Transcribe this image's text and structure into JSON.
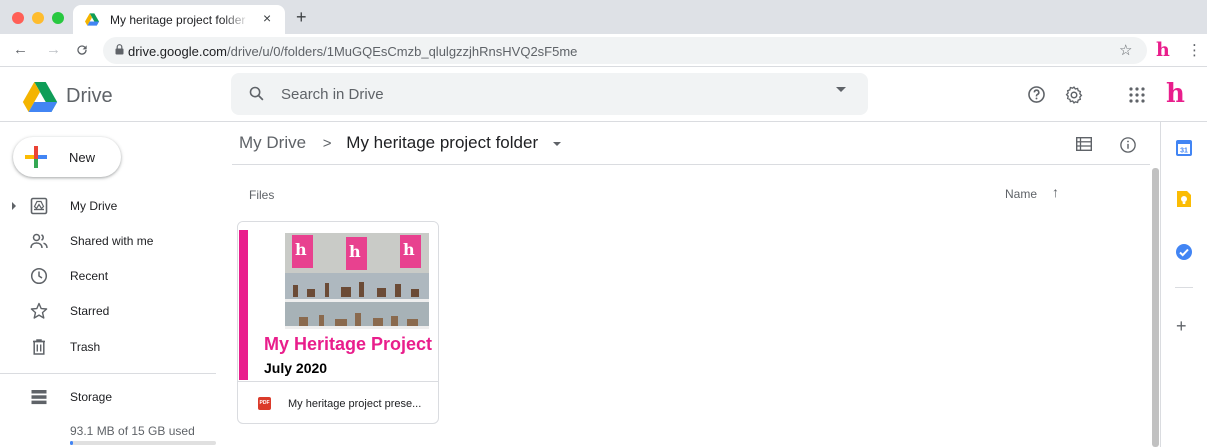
{
  "browser": {
    "tab_title": "My heritage project folder - Google Drive",
    "new_tab_label": "+",
    "close_label": "×",
    "url_host": "drive.google.com",
    "url_path": "/drive/u/0/folders/1MuGQEsCmzb_qlulgzzjhRnsHVQ2sF5me"
  },
  "drive": {
    "app_title": "Drive",
    "search_placeholder": "Search in Drive",
    "brand_letter": "h"
  },
  "sidebar": {
    "new_label": "New",
    "items": [
      {
        "label": "My Drive",
        "icon": "my-drive-icon"
      },
      {
        "label": "Shared with me",
        "icon": "people-icon"
      },
      {
        "label": "Recent",
        "icon": "clock-icon"
      },
      {
        "label": "Starred",
        "icon": "star-icon"
      },
      {
        "label": "Trash",
        "icon": "trash-icon"
      }
    ],
    "storage": {
      "label": "Storage",
      "used_text": "93.1 MB of 15 GB used",
      "used_fraction": 0.006
    }
  },
  "main": {
    "breadcrumb": {
      "root": "My Drive",
      "separator": ">",
      "current": "My heritage project folder"
    },
    "files_heading": "Files",
    "sort": {
      "label": "Name",
      "arrow": "↑"
    },
    "files": [
      {
        "name": "My heritage project prese...",
        "type_badge": "PDF",
        "thumbnail_title": "My Heritage Project",
        "thumbnail_date": "July 2020",
        "thumbnail_letter": "h"
      }
    ]
  },
  "right_rail": {
    "calendar_day": "31",
    "add_label": "+"
  },
  "colors": {
    "accent_pink": "#e91e8c",
    "google_blue": "#4285f4",
    "google_green": "#0f9d58",
    "google_yellow": "#f4b400",
    "google_red": "#db4437"
  }
}
